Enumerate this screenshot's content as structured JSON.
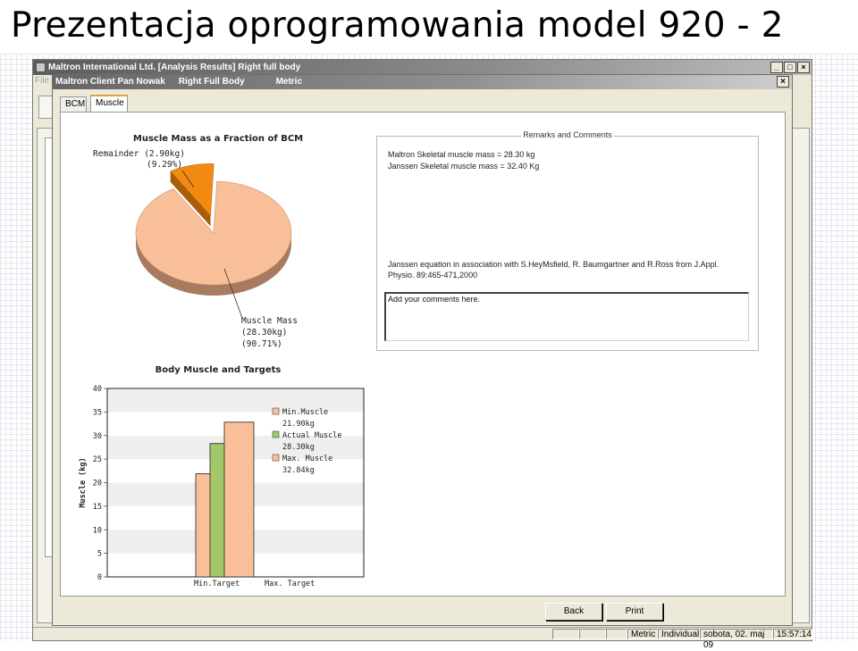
{
  "slide": {
    "title": "Prezentacja oprogramowania model 920 - 2"
  },
  "outer_window": {
    "title": "Maltron International Ltd. [Analysis Results] Right full body",
    "menu_first": "File",
    "controls": {
      "minimize": "_",
      "maximize": "□",
      "close": "×"
    }
  },
  "dialog": {
    "title_client": "Maltron Client Pan Nowak",
    "title_body": "Right Full Body",
    "title_units": "Metric",
    "close": "×",
    "tabs": [
      {
        "label": "BCM",
        "active": false
      },
      {
        "label": "Muscle",
        "active": true
      }
    ],
    "buttons": {
      "back": "Back",
      "print": "Print"
    }
  },
  "remarks": {
    "legend": "Remarks and Comments",
    "maltron_line": "Maltron Skeletal muscle mass  =  28.30 kg",
    "janssen_line": "Janssen Skeletal muscle mass =  32.40 Kg",
    "reference_line1": "Janssen equation in association with S.HeyMsfield, R. Baumgartner and R.Ross from J.Appl.",
    "reference_line2": "Physio. 89:465-471,2000",
    "comments_value": "Add your comments here."
  },
  "status_bar": {
    "units": "Metric",
    "mode": "Individual",
    "date": "sobota, 02. maj 09",
    "time": "15:57:14"
  },
  "chart_data": [
    {
      "type": "pie",
      "title": "Muscle Mass as a Fraction of BCM",
      "slices": [
        {
          "name": "Muscle Mass",
          "value_kg": 28.3,
          "percent": 90.71,
          "label_line1": "Muscle Mass",
          "label_line2": "(28.30kg)",
          "label_line3": "(90.71%)",
          "color": "#f9bf98",
          "side_color": "#a87a60"
        },
        {
          "name": "Remainder",
          "value_kg": 2.9,
          "percent": 9.29,
          "label_line1": "Remainder (2.90kg)",
          "label_line2": "(9.29%)",
          "color": "#f28a12",
          "side_color": "#a85d0a"
        }
      ]
    },
    {
      "type": "bar",
      "title": "Body Muscle and Targets",
      "ylabel": "Muscle (kg)",
      "xlabel": "",
      "ylim": [
        0,
        40
      ],
      "yticks": [
        "0",
        "5",
        "10",
        "15",
        "20",
        "25",
        "30",
        "35",
        "40"
      ],
      "categories": [
        "Min.Target",
        "Max. Target"
      ],
      "grid": true,
      "legend_position": "right",
      "series": [
        {
          "name": "Min.Muscle",
          "legend_value": "21.90kg",
          "value": 21.9,
          "color": "#f9bf98"
        },
        {
          "name": "Actual Muscle",
          "legend_value": "28.30kg",
          "value": 28.3,
          "color": "#a3c86a"
        },
        {
          "name": "Max. Muscle",
          "legend_value": "32.84kg",
          "value": 32.84,
          "color": "#f9bf98"
        }
      ]
    }
  ]
}
